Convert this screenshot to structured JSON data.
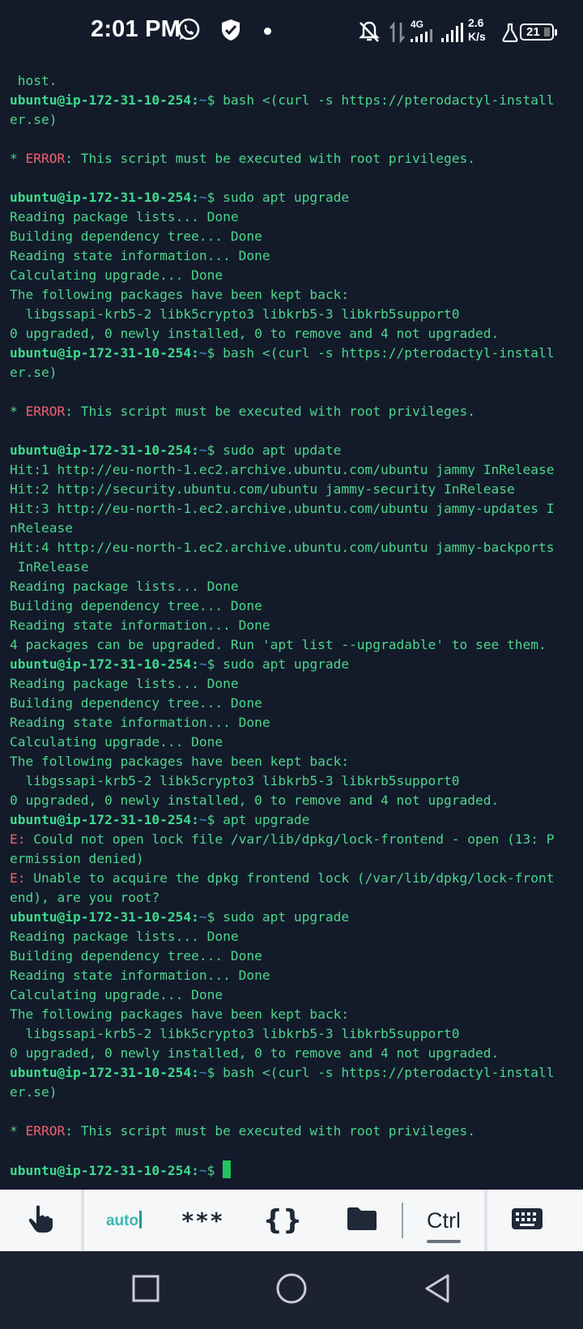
{
  "status_bar": {
    "time": "2:01 PM",
    "network_type": "4G",
    "speed_value": "2.6",
    "speed_unit": "K/s",
    "battery_level": "21",
    "icons": [
      "whatsapp-icon",
      "shield-check-icon",
      "notification-dot-icon",
      "bell-off-icon",
      "data-arrows-icon",
      "signal-icon",
      "signal-2-icon",
      "flask-icon",
      "battery-icon"
    ]
  },
  "terminal": {
    "colors": {
      "background": "#131b2b",
      "text": "#4cd68a",
      "user": "#3ddb8c",
      "path": "#3f8dd8",
      "error": "#f0616d",
      "cursor": "#22c55e"
    },
    "lines": [
      {
        "type": "text",
        "text": " host."
      },
      {
        "type": "prompt",
        "user": "ubuntu@ip-172-31-10-254:",
        "path": "~",
        "cmd": "$ bash <(curl -s https://pterodactyl-install"
      },
      {
        "type": "text",
        "text": "er.se)"
      },
      {
        "type": "blank",
        "text": ""
      },
      {
        "type": "error",
        "prefix": "* ",
        "label": "ERROR",
        "text": ": This script must be executed with root privileges."
      },
      {
        "type": "blank",
        "text": ""
      },
      {
        "type": "prompt",
        "user": "ubuntu@ip-172-31-10-254:",
        "path": "~",
        "cmd": "$ sudo apt upgrade"
      },
      {
        "type": "text",
        "text": "Reading package lists... Done"
      },
      {
        "type": "text",
        "text": "Building dependency tree... Done"
      },
      {
        "type": "text",
        "text": "Reading state information... Done"
      },
      {
        "type": "text",
        "text": "Calculating upgrade... Done"
      },
      {
        "type": "text",
        "text": "The following packages have been kept back:"
      },
      {
        "type": "text",
        "text": "  libgssapi-krb5-2 libk5crypto3 libkrb5-3 libkrb5support0"
      },
      {
        "type": "text",
        "text": "0 upgraded, 0 newly installed, 0 to remove and 4 not upgraded."
      },
      {
        "type": "prompt",
        "user": "ubuntu@ip-172-31-10-254:",
        "path": "~",
        "cmd": "$ bash <(curl -s https://pterodactyl-install"
      },
      {
        "type": "text",
        "text": "er.se)"
      },
      {
        "type": "blank",
        "text": ""
      },
      {
        "type": "error",
        "prefix": "* ",
        "label": "ERROR",
        "text": ": This script must be executed with root privileges."
      },
      {
        "type": "blank",
        "text": ""
      },
      {
        "type": "prompt",
        "user": "ubuntu@ip-172-31-10-254:",
        "path": "~",
        "cmd": "$ sudo apt update"
      },
      {
        "type": "text",
        "text": "Hit:1 http://eu-north-1.ec2.archive.ubuntu.com/ubuntu jammy InRelease"
      },
      {
        "type": "text",
        "text": "Hit:2 http://security.ubuntu.com/ubuntu jammy-security InRelease"
      },
      {
        "type": "text",
        "text": "Hit:3 http://eu-north-1.ec2.archive.ubuntu.com/ubuntu jammy-updates I"
      },
      {
        "type": "text",
        "text": "nRelease"
      },
      {
        "type": "text",
        "text": "Hit:4 http://eu-north-1.ec2.archive.ubuntu.com/ubuntu jammy-backports"
      },
      {
        "type": "text",
        "text": " InRelease"
      },
      {
        "type": "text",
        "text": "Reading package lists... Done"
      },
      {
        "type": "text",
        "text": "Building dependency tree... Done"
      },
      {
        "type": "text",
        "text": "Reading state information... Done"
      },
      {
        "type": "text",
        "text": "4 packages can be upgraded. Run 'apt list --upgradable' to see them."
      },
      {
        "type": "prompt",
        "user": "ubuntu@ip-172-31-10-254:",
        "path": "~",
        "cmd": "$ sudo apt upgrade"
      },
      {
        "type": "text",
        "text": "Reading package lists... Done"
      },
      {
        "type": "text",
        "text": "Building dependency tree... Done"
      },
      {
        "type": "text",
        "text": "Reading state information... Done"
      },
      {
        "type": "text",
        "text": "Calculating upgrade... Done"
      },
      {
        "type": "text",
        "text": "The following packages have been kept back:"
      },
      {
        "type": "text",
        "text": "  libgssapi-krb5-2 libk5crypto3 libkrb5-3 libkrb5support0"
      },
      {
        "type": "text",
        "text": "0 upgraded, 0 newly installed, 0 to remove and 4 not upgraded."
      },
      {
        "type": "prompt",
        "user": "ubuntu@ip-172-31-10-254:",
        "path": "~",
        "cmd": "$ apt upgrade"
      },
      {
        "type": "error",
        "prefix": "",
        "label": "E:",
        "text": " Could not open lock file /var/lib/dpkg/lock-frontend - open (13: P"
      },
      {
        "type": "text",
        "text": "ermission denied)"
      },
      {
        "type": "error",
        "prefix": "",
        "label": "E:",
        "text": " Unable to acquire the dpkg frontend lock (/var/lib/dpkg/lock-front"
      },
      {
        "type": "text",
        "text": "end), are you root?"
      },
      {
        "type": "prompt",
        "user": "ubuntu@ip-172-31-10-254:",
        "path": "~",
        "cmd": "$ sudo apt upgrade"
      },
      {
        "type": "text",
        "text": "Reading package lists... Done"
      },
      {
        "type": "text",
        "text": "Building dependency tree... Done"
      },
      {
        "type": "text",
        "text": "Reading state information... Done"
      },
      {
        "type": "text",
        "text": "Calculating upgrade... Done"
      },
      {
        "type": "text",
        "text": "The following packages have been kept back:"
      },
      {
        "type": "text",
        "text": "  libgssapi-krb5-2 libk5crypto3 libkrb5-3 libkrb5support0"
      },
      {
        "type": "text",
        "text": "0 upgraded, 0 newly installed, 0 to remove and 4 not upgraded."
      },
      {
        "type": "prompt",
        "user": "ubuntu@ip-172-31-10-254:",
        "path": "~",
        "cmd": "$ bash <(curl -s https://pterodactyl-install"
      },
      {
        "type": "text",
        "text": "er.se)"
      },
      {
        "type": "blank",
        "text": ""
      },
      {
        "type": "error",
        "prefix": "* ",
        "label": "ERROR",
        "text": ": This script must be executed with root privileges."
      },
      {
        "type": "blank",
        "text": ""
      },
      {
        "type": "prompt",
        "user": "ubuntu@ip-172-31-10-254:",
        "path": "~",
        "cmd": "$ ",
        "cursor": true
      }
    ]
  },
  "toolbar": {
    "touch_icon": "hand-pointer-icon",
    "auto_label": "auto",
    "password_label": "***",
    "braces_label": "{}",
    "folder_icon": "folder-icon",
    "ctrl_label": "Ctrl",
    "keyboard_icon": "keyboard-icon"
  },
  "nav_bar": {
    "icons": [
      "recent-apps-icon",
      "home-icon",
      "back-icon"
    ]
  }
}
